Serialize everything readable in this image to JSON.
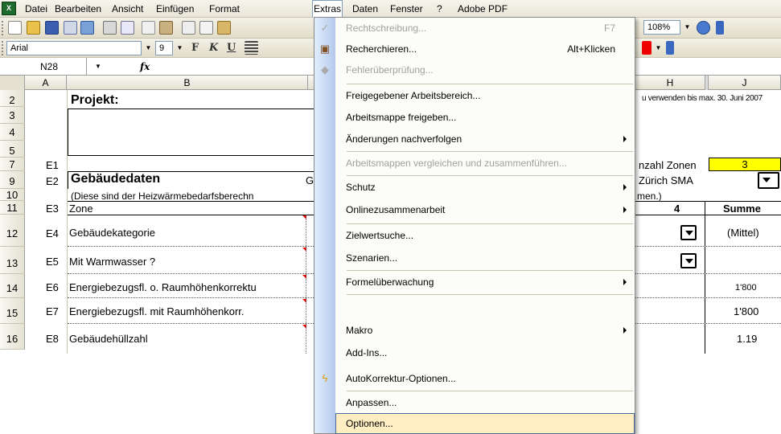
{
  "app": {
    "icon": "excel-icon"
  },
  "menubar": {
    "items": [
      "Datei",
      "Bearbeiten",
      "Ansicht",
      "Einfügen",
      "Format",
      "Extras",
      "Daten",
      "Fenster",
      "?",
      "Adobe PDF"
    ]
  },
  "toolbar": {
    "font_name": "Arial",
    "font_size": "9",
    "zoom": "108%",
    "bold": "F",
    "italic": "K",
    "underline": "U"
  },
  "namebar": {
    "cell_ref": "N28",
    "fx": "fx"
  },
  "columns": [
    "A",
    "B",
    "H",
    "J"
  ],
  "rows": [
    "2",
    "3",
    "4",
    "5",
    "7",
    "9",
    "10",
    "11",
    "12",
    "13",
    "14",
    "15",
    "16"
  ],
  "sheet": {
    "projekt_label": "Projekt:",
    "note_right": "u verwenden bis max. 30. Juni 2007",
    "e1": "E1",
    "anzahl_zonen_label": "nzahl Zonen",
    "anzahl_zonen_value": "3",
    "e2": "E2",
    "gebaeudedaten": "Gebäudedaten",
    "g_cut": "G",
    "station": "Zürich SMA",
    "hint": "(Diese sind der Heizwärmebedarfsberechn",
    "hint_right": "men.)",
    "e3": "E3",
    "zone": "Zone",
    "zone_4": "4",
    "summe": "Summe",
    "e4": "E4",
    "gebaeudekategorie": "Gebäudekategorie",
    "mittel": "(Mittel)",
    "e5": "E5",
    "warmwasser": "Mit Warmwasser ?",
    "e6": "E6",
    "ebf_ohne": "Energiebezugsfl. o. Raumhöhenkorrektu",
    "ebf_ohne_val": "1'800",
    "e7": "E7",
    "ebf_mit": "Energiebezugsfl. mit Raumhöhenkorr.",
    "ebf_mit_val": "1'800",
    "e8": "E8",
    "huellzahl": "Gebäudehüllzahl",
    "huellzahl_val": "1.19"
  },
  "menu": {
    "items": [
      {
        "label": "Rechtschreibung...",
        "shortcut": "F7",
        "disabled": true,
        "icon": "spellcheck-icon"
      },
      {
        "label": "Recherchieren...",
        "shortcut": "Alt+Klicken",
        "icon": "research-icon"
      },
      {
        "label": "Fehlerüberprüfung...",
        "disabled": true,
        "icon": "error-check-icon"
      },
      {
        "label": "Freigegebener Arbeitsbereich..."
      },
      {
        "label": "Arbeitsmappe freigeben..."
      },
      {
        "label": "Änderungen nachverfolgen",
        "submenu": true
      },
      {
        "label": "Arbeitsmappen vergleichen und zusammenführen...",
        "disabled": true
      },
      {
        "label": "Schutz",
        "submenu": true
      },
      {
        "label": "Onlinezusammenarbeit",
        "submenu": true
      },
      {
        "label": "Zielwertsuche..."
      },
      {
        "label": "Szenarien..."
      },
      {
        "label": "Formelüberwachung",
        "submenu": true
      },
      {
        "label": "Makro",
        "submenu": true
      },
      {
        "label": "Add-Ins..."
      },
      {
        "label": "AutoKorrektur-Optionen...",
        "icon": "autocorrect-icon"
      },
      {
        "label": "Anpassen..."
      },
      {
        "label": "Optionen...",
        "hover": true
      }
    ]
  },
  "colors": {
    "highlight": "#ffeec2",
    "yellow_cell": "#ffff00"
  }
}
